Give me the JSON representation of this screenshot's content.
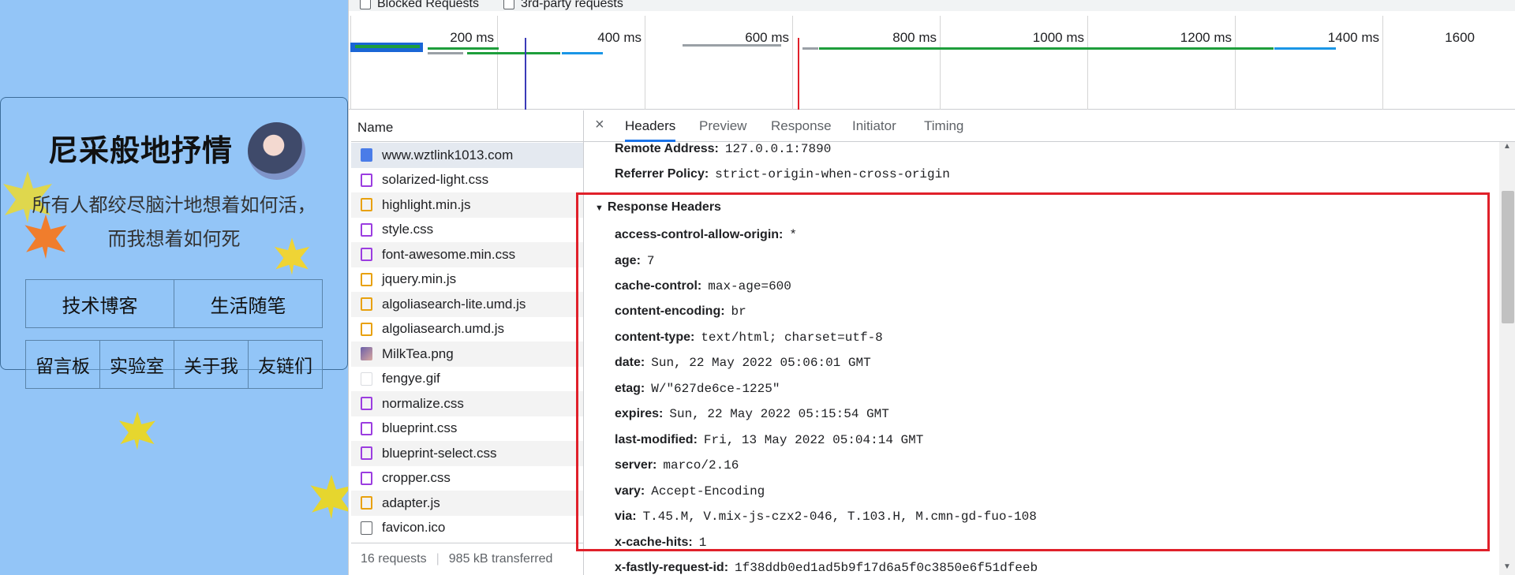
{
  "blog": {
    "title": "尼采般地抒情",
    "tagline_1": "所有人都绞尽脑汁地想着如何活，",
    "tagline_2": "而我想着如何死",
    "nav": [
      {
        "label": "技术博客"
      },
      {
        "label": "生活随笔"
      },
      {
        "label": "留言板"
      },
      {
        "label": "实验室"
      },
      {
        "label": "关于我"
      },
      {
        "label": "友链们"
      }
    ]
  },
  "devtools": {
    "toolbar": {
      "blocked_label": "Blocked Requests",
      "third_party_label": "3rd-party requests"
    },
    "timeline": {
      "ticks": [
        "200 ms",
        "400 ms",
        "600 ms",
        "800 ms",
        "1000 ms",
        "1200 ms",
        "1400 ms",
        "1600"
      ]
    },
    "network": {
      "name_header": "Name",
      "requests": [
        {
          "name": "www.wztlink1013.com",
          "type": "document"
        },
        {
          "name": "solarized-light.css",
          "type": "css"
        },
        {
          "name": "highlight.min.js",
          "type": "js"
        },
        {
          "name": "style.css",
          "type": "css"
        },
        {
          "name": "font-awesome.min.css",
          "type": "css"
        },
        {
          "name": "jquery.min.js",
          "type": "js"
        },
        {
          "name": "algoliasearch-lite.umd.js",
          "type": "js"
        },
        {
          "name": "algoliasearch.umd.js",
          "type": "js"
        },
        {
          "name": "MilkTea.png",
          "type": "image"
        },
        {
          "name": "fengye.gif",
          "type": "gif"
        },
        {
          "name": "normalize.css",
          "type": "css"
        },
        {
          "name": "blueprint.css",
          "type": "css"
        },
        {
          "name": "blueprint-select.css",
          "type": "css"
        },
        {
          "name": "cropper.css",
          "type": "css"
        },
        {
          "name": "adapter.js",
          "type": "js"
        },
        {
          "name": "favicon.ico",
          "type": "other"
        }
      ],
      "summary_requests": "16 requests",
      "summary_transferred": "985 kB transferred"
    },
    "tabs": [
      "Headers",
      "Preview",
      "Response",
      "Initiator",
      "Timing"
    ],
    "general": [
      {
        "key": "Remote Address:",
        "value": "127.0.0.1:7890"
      },
      {
        "key": "Referrer Policy:",
        "value": "strict-origin-when-cross-origin"
      }
    ],
    "response_headers_title": "Response Headers",
    "response_headers": [
      {
        "key": "access-control-allow-origin:",
        "value": "*"
      },
      {
        "key": "age:",
        "value": "7"
      },
      {
        "key": "cache-control:",
        "value": "max-age=600"
      },
      {
        "key": "content-encoding:",
        "value": "br"
      },
      {
        "key": "content-type:",
        "value": "text/html; charset=utf-8"
      },
      {
        "key": "date:",
        "value": "Sun, 22 May 2022 05:06:01 GMT"
      },
      {
        "key": "etag:",
        "value": "W/\"627de6ce-1225\""
      },
      {
        "key": "expires:",
        "value": "Sun, 22 May 2022 05:15:54 GMT"
      },
      {
        "key": "last-modified:",
        "value": "Fri, 13 May 2022 05:04:14 GMT"
      },
      {
        "key": "server:",
        "value": "marco/2.16"
      },
      {
        "key": "vary:",
        "value": "Accept-Encoding"
      },
      {
        "key": "via:",
        "value": "T.45.M, V.mix-js-czx2-046, T.103.H, M.cmn-gd-fuo-108"
      },
      {
        "key": "x-cache-hits:",
        "value": "1"
      },
      {
        "key": "x-fastly-request-id:",
        "value": "1f38ddb0ed1ad5b9f17d6a5f0c3850e6f51dfeeb"
      }
    ],
    "colors": {
      "highlight_border": "#e0202a",
      "tab_accent": "#1a73e8",
      "page_bg": "#93c5f7"
    }
  }
}
